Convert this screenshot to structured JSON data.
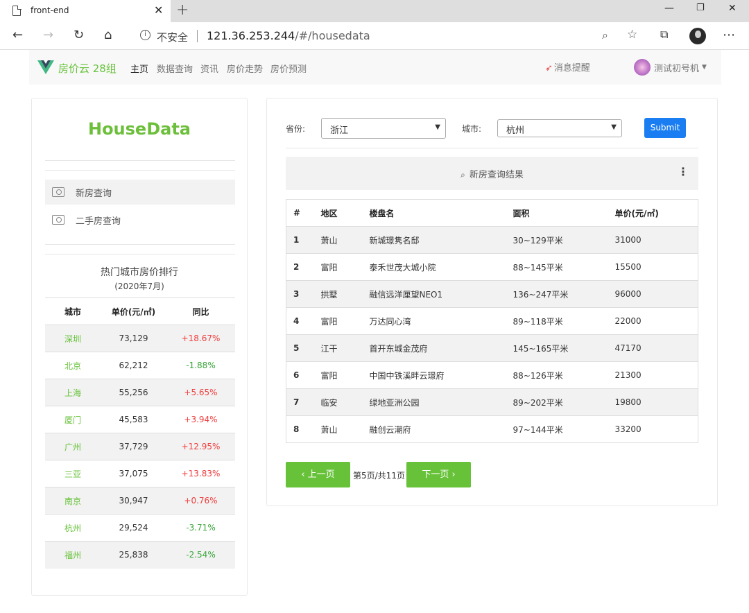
{
  "browser": {
    "tab_title": "front-end",
    "insecure_label": "不安全",
    "url_host": "121.36.253.244",
    "url_path": "/#/housedata"
  },
  "nav": {
    "brand": "房价云 28组",
    "items": [
      "主页",
      "数据查询",
      "资讯",
      "房价走势",
      "房价预测"
    ],
    "notify": "消息提醒",
    "user": "测试初号机"
  },
  "sidebar": {
    "title": "HouseData",
    "menu": [
      "新房查询",
      "二手房查询"
    ],
    "rank_title": "热门城市房价排行",
    "rank_subtitle": "(2020年7月)",
    "rank_headers": [
      "城市",
      "单价(元/㎡)",
      "同比"
    ],
    "rank_rows": [
      {
        "city": "深圳",
        "price": "73,129",
        "yoy": "+18.67%"
      },
      {
        "city": "北京",
        "price": "62,212",
        "yoy": "-1.88%"
      },
      {
        "city": "上海",
        "price": "55,256",
        "yoy": "+5.65%"
      },
      {
        "city": "厦门",
        "price": "45,583",
        "yoy": "+3.94%"
      },
      {
        "city": "广州",
        "price": "37,729",
        "yoy": "+12.95%"
      },
      {
        "city": "三亚",
        "price": "37,075",
        "yoy": "+13.83%"
      },
      {
        "city": "南京",
        "price": "30,947",
        "yoy": "+0.76%"
      },
      {
        "city": "杭州",
        "price": "29,524",
        "yoy": "-3.71%"
      },
      {
        "city": "福州",
        "price": "25,838",
        "yoy": "-2.54%"
      }
    ]
  },
  "query": {
    "province_label": "省份:",
    "province_value": "浙江",
    "city_label": "城市:",
    "city_value": "杭州",
    "submit_label": "Submit",
    "result_title": "新房查询结果"
  },
  "results": {
    "headers": [
      "#",
      "地区",
      "楼盘名",
      "面积",
      "单价(元/㎡)"
    ],
    "rows": [
      {
        "no": "1",
        "area": "萧山",
        "name": "新城璟隽名邸",
        "size": "30~129平米",
        "price": "31000"
      },
      {
        "no": "2",
        "area": "富阳",
        "name": "泰禾世茂大城小院",
        "size": "88~145平米",
        "price": "15500"
      },
      {
        "no": "3",
        "area": "拱墅",
        "name": "融信远洋厘望NEO1",
        "size": "136~247平米",
        "price": "96000"
      },
      {
        "no": "4",
        "area": "富阳",
        "name": "万达同心湾",
        "size": "89~118平米",
        "price": "22000"
      },
      {
        "no": "5",
        "area": "江干",
        "name": "首开东城金茂府",
        "size": "145~165平米",
        "price": "47170"
      },
      {
        "no": "6",
        "area": "富阳",
        "name": "中国中铁溪畔云璟府",
        "size": "88~126平米",
        "price": "21300"
      },
      {
        "no": "7",
        "area": "临安",
        "name": "绿地亚洲公园",
        "size": "89~202平米",
        "price": "19800"
      },
      {
        "no": "8",
        "area": "萧山",
        "name": "融创云潮府",
        "size": "97~144平米",
        "price": "33200"
      }
    ]
  },
  "pagination": {
    "prev_label": "‹ 上一页",
    "info": "第5页/共11页",
    "next_label": "下一页 ›"
  },
  "colors": {
    "brand_green": "#67c23a",
    "primary_blue": "#1a7ef2",
    "up_red": "#f03e3e",
    "down_green": "#3aa53a"
  }
}
